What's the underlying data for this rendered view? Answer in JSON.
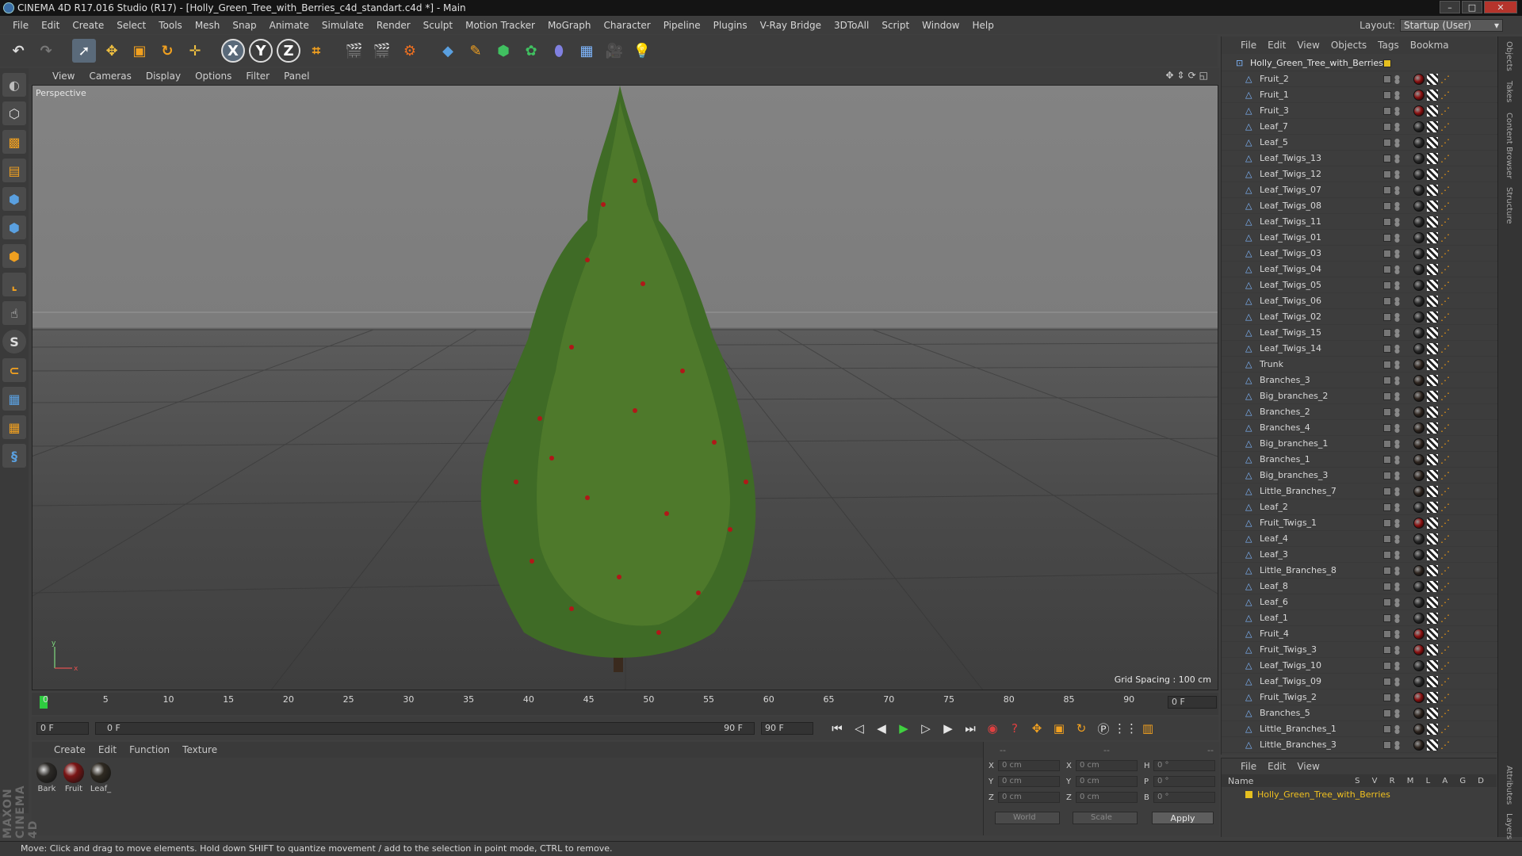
{
  "window": {
    "title": "CINEMA 4D R17.016 Studio (R17) - [Holly_Green_Tree_with_Berries_c4d_standart.c4d *] - Main"
  },
  "menubar": [
    "File",
    "Edit",
    "Create",
    "Select",
    "Tools",
    "Mesh",
    "Snap",
    "Animate",
    "Simulate",
    "Render",
    "Sculpt",
    "Motion Tracker",
    "MoGraph",
    "Character",
    "Pipeline",
    "Plugins",
    "V-Ray Bridge",
    "3DToAll",
    "Script",
    "Window",
    "Help"
  ],
  "layout": {
    "label": "Layout:",
    "value": "Startup (User)"
  },
  "viewport": {
    "menu": [
      "View",
      "Cameras",
      "Display",
      "Options",
      "Filter",
      "Panel"
    ],
    "label": "Perspective",
    "grid_spacing": "Grid Spacing : 100 cm"
  },
  "timeline": {
    "ticks": [
      "0",
      "5",
      "10",
      "15",
      "20",
      "25",
      "30",
      "35",
      "40",
      "45",
      "50",
      "55",
      "60",
      "65",
      "70",
      "75",
      "80",
      "85",
      "90"
    ],
    "current": "0 F",
    "start_field": "0 F",
    "range_start": "0 F",
    "range_end": "90 F",
    "end_field": "90 F"
  },
  "material_panel": {
    "menu": [
      "Create",
      "Edit",
      "Function",
      "Texture"
    ],
    "materials": [
      {
        "name": "Bark",
        "color": "#2c2a27"
      },
      {
        "name": "Fruit",
        "color": "#7a1515"
      },
      {
        "name": "Leaf_",
        "color": "#2f2a22"
      }
    ]
  },
  "coords": {
    "header": [
      "--",
      "--",
      "--"
    ],
    "rows": [
      {
        "a": "X",
        "av": "0 cm",
        "b": "X",
        "bv": "0 cm",
        "c": "H",
        "cv": "0 °"
      },
      {
        "a": "Y",
        "av": "0 cm",
        "b": "Y",
        "bv": "0 cm",
        "c": "P",
        "cv": "0 °"
      },
      {
        "a": "Z",
        "av": "0 cm",
        "b": "Z",
        "bv": "0 cm",
        "c": "B",
        "cv": "0 °"
      }
    ],
    "mode": "World",
    "transform": "Scale",
    "apply": "Apply"
  },
  "objects_panel": {
    "menu": [
      "File",
      "Edit",
      "View",
      "Objects",
      "Tags",
      "Bookma"
    ],
    "root": "Holly_Green_Tree_with_Berries",
    "items": [
      {
        "name": "Fruit_2",
        "mat": "fruit"
      },
      {
        "name": "Fruit_1",
        "mat": "fruit"
      },
      {
        "name": "Fruit_3",
        "mat": "fruit"
      },
      {
        "name": "Leaf_7",
        "mat": "leaf"
      },
      {
        "name": "Leaf_5",
        "mat": "leaf"
      },
      {
        "name": "Leaf_Twigs_13",
        "mat": "leaf"
      },
      {
        "name": "Leaf_Twigs_12",
        "mat": "leaf"
      },
      {
        "name": "Leaf_Twigs_07",
        "mat": "leaf"
      },
      {
        "name": "Leaf_Twigs_08",
        "mat": "leaf"
      },
      {
        "name": "Leaf_Twigs_11",
        "mat": "leaf"
      },
      {
        "name": "Leaf_Twigs_01",
        "mat": "leaf"
      },
      {
        "name": "Leaf_Twigs_03",
        "mat": "leaf"
      },
      {
        "name": "Leaf_Twigs_04",
        "mat": "leaf"
      },
      {
        "name": "Leaf_Twigs_05",
        "mat": "leaf"
      },
      {
        "name": "Leaf_Twigs_06",
        "mat": "leaf"
      },
      {
        "name": "Leaf_Twigs_02",
        "mat": "leaf"
      },
      {
        "name": "Leaf_Twigs_15",
        "mat": "leaf"
      },
      {
        "name": "Leaf_Twigs_14",
        "mat": "leaf"
      },
      {
        "name": "Trunk",
        "mat": "bark"
      },
      {
        "name": "Branches_3",
        "mat": "bark"
      },
      {
        "name": "Big_branches_2",
        "mat": "bark"
      },
      {
        "name": "Branches_2",
        "mat": "bark"
      },
      {
        "name": "Branches_4",
        "mat": "bark"
      },
      {
        "name": "Big_branches_1",
        "mat": "bark"
      },
      {
        "name": "Branches_1",
        "mat": "bark"
      },
      {
        "name": "Big_branches_3",
        "mat": "bark"
      },
      {
        "name": "Little_Branches_7",
        "mat": "bark"
      },
      {
        "name": "Leaf_2",
        "mat": "leaf"
      },
      {
        "name": "Fruit_Twigs_1",
        "mat": "fruit"
      },
      {
        "name": "Leaf_4",
        "mat": "leaf"
      },
      {
        "name": "Leaf_3",
        "mat": "leaf"
      },
      {
        "name": "Little_Branches_8",
        "mat": "bark"
      },
      {
        "name": "Leaf_8",
        "mat": "leaf"
      },
      {
        "name": "Leaf_6",
        "mat": "leaf"
      },
      {
        "name": "Leaf_1",
        "mat": "leaf"
      },
      {
        "name": "Fruit_4",
        "mat": "fruit"
      },
      {
        "name": "Fruit_Twigs_3",
        "mat": "fruit"
      },
      {
        "name": "Leaf_Twigs_10",
        "mat": "leaf"
      },
      {
        "name": "Leaf_Twigs_09",
        "mat": "leaf"
      },
      {
        "name": "Fruit_Twigs_2",
        "mat": "fruit"
      },
      {
        "name": "Branches_5",
        "mat": "bark"
      },
      {
        "name": "Little_Branches_1",
        "mat": "bark"
      },
      {
        "name": "Little_Branches_3",
        "mat": "bark"
      }
    ]
  },
  "side_tabs": [
    "Objects",
    "Takes",
    "Content Browser",
    "Structure",
    "Attributes",
    "Layers"
  ],
  "layers_panel": {
    "menu": [
      "File",
      "Edit",
      "View"
    ],
    "header_name": "Name",
    "columns": "S V R M L A G D",
    "row": "Holly_Green_Tree_with_Berries"
  },
  "statusbar": "Move: Click and drag to move elements. Hold down SHIFT to quantize movement / add to the selection in point mode, CTRL to remove.",
  "brand": "MAXON CINEMA 4D",
  "colors": {
    "accent": "#5a6a7a",
    "leaf": "#3f6b26",
    "berry": "#b01818",
    "object_icon": "#7fb7ff"
  }
}
